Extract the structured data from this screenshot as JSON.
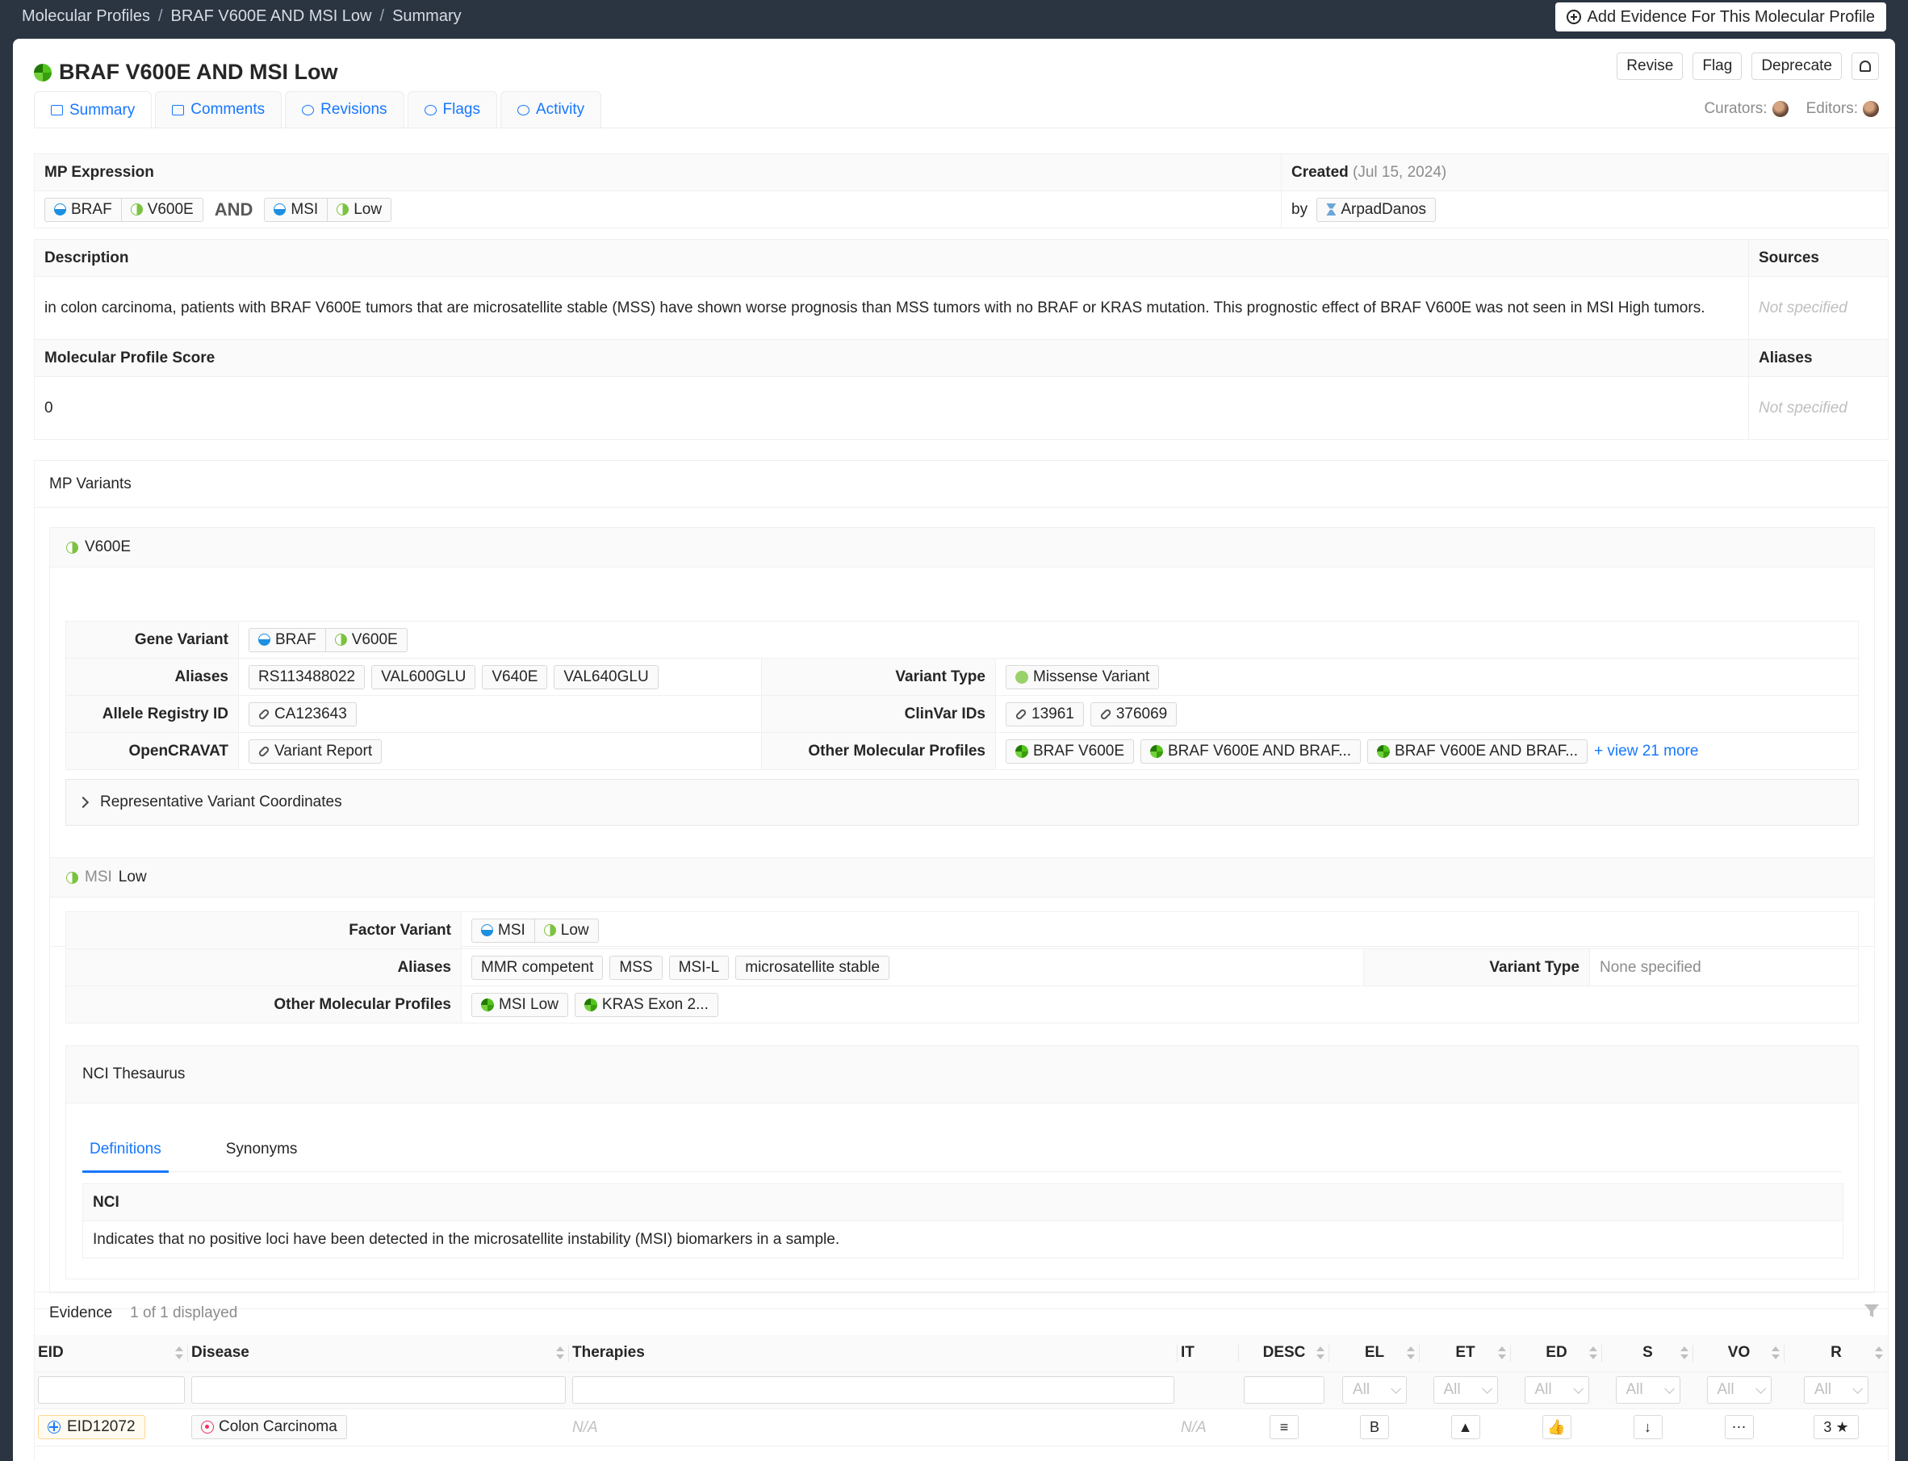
{
  "breadcrumb": [
    "Molecular Profiles",
    "BRAF V600E AND MSI Low",
    "Summary"
  ],
  "add_evidence_label": "Add Evidence For This Molecular Profile",
  "title": "BRAF V600E AND MSI Low",
  "actions": {
    "revise": "Revise",
    "flag": "Flag",
    "deprecate": "Deprecate"
  },
  "tabs": [
    {
      "label": "Summary"
    },
    {
      "label": "Comments"
    },
    {
      "label": "Revisions"
    },
    {
      "label": "Flags"
    },
    {
      "label": "Activity"
    }
  ],
  "curators_label": "Curators:",
  "editors_label": "Editors:",
  "summary": {
    "mp_expression_label": "MP Expression",
    "expression": {
      "gene1": "BRAF",
      "variant1": "V600E",
      "operator": "AND",
      "gene2": "MSI",
      "variant2": "Low"
    },
    "created_label": "Created",
    "created_date": "(Jul 15, 2024)",
    "by_label": "by",
    "creator": "ArpadDanos",
    "description_label": "Description",
    "description": "in colon carcinoma, patients with BRAF V600E tumors that are microsatellite stable (MSS) have shown worse prognosis than MSS tumors with no BRAF or KRAS mutation. This prognostic effect of BRAF V600E was not seen in MSI High tumors.",
    "sources_label": "Sources",
    "sources_value": "Not specified",
    "score_label": "Molecular Profile Score",
    "score": "0",
    "aliases_label": "Aliases",
    "aliases_value": "Not specified"
  },
  "mp_variants": {
    "heading": "MP Variants",
    "v600e": {
      "name": "V600E",
      "gene_variant_label": "Gene Variant",
      "gene": "BRAF",
      "variant": "V600E",
      "aliases_label": "Aliases",
      "aliases": [
        "RS113488022",
        "VAL600GLU",
        "V640E",
        "VAL640GLU"
      ],
      "variant_type_label": "Variant Type",
      "variant_type": "Missense Variant",
      "allele_label": "Allele Registry ID",
      "allele_id": "CA123643",
      "clinvar_label": "ClinVar IDs",
      "clinvar": [
        "13961",
        "376069"
      ],
      "opencravat_label": "OpenCRAVAT",
      "opencravat": "Variant Report",
      "other_mp_label": "Other Molecular Profiles",
      "other_mps": [
        "BRAF V600E",
        "BRAF V600E AND BRAF...",
        "BRAF V600E AND BRAF..."
      ],
      "view_more": "+ view 21 more",
      "coords_label": "Representative Variant Coordinates"
    },
    "msi": {
      "gene": "MSI",
      "name": "Low",
      "factor_variant_label": "Factor Variant",
      "factor": "MSI",
      "variant": "Low",
      "aliases_label": "Aliases",
      "aliases": [
        "MMR competent",
        "MSS",
        "MSI-L",
        "microsatellite stable"
      ],
      "variant_type_label": "Variant Type",
      "variant_type": "None specified",
      "other_mp_label": "Other Molecular Profiles",
      "other_mps": [
        "MSI Low",
        "KRAS Exon 2..."
      ],
      "nci": {
        "heading": "NCI Thesaurus",
        "tab_definitions": "Definitions",
        "tab_synonyms": "Synonyms",
        "source": "NCI",
        "definition": "Indicates that no positive loci have been detected in the microsatellite instability (MSI) biomarkers in a sample."
      }
    }
  },
  "evidence": {
    "heading": "Evidence",
    "count": "1 of 1 displayed",
    "columns": [
      "EID",
      "Disease",
      "Therapies",
      "IT",
      "DESC",
      "EL",
      "ET",
      "ED",
      "S",
      "VO",
      "R"
    ],
    "filter_all": "All",
    "row": {
      "eid": "EID12072",
      "disease": "Colon Carcinoma",
      "therapies": "N/A",
      "it": "N/A",
      "el": "B",
      "r": "3"
    }
  }
}
